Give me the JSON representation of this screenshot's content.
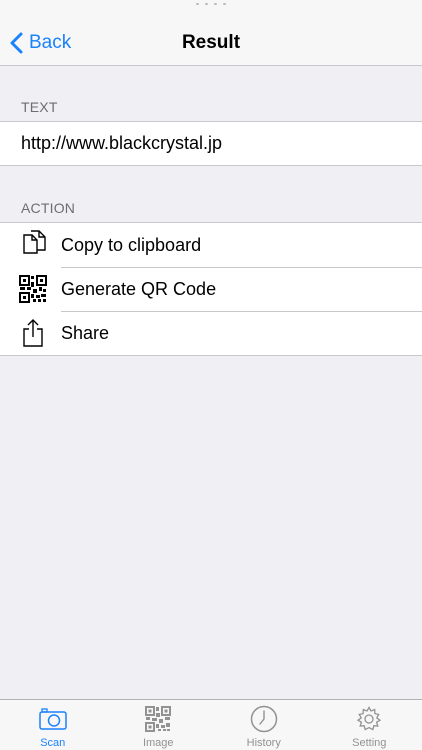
{
  "navbar": {
    "back_label": "Back",
    "title": "Result"
  },
  "text_section": {
    "header": "TEXT",
    "value": "http://www.blackcrystal.jp"
  },
  "action_section": {
    "header": "ACTION",
    "items": [
      {
        "label": "Copy to clipboard",
        "icon": "copy-icon"
      },
      {
        "label": "Generate QR Code",
        "icon": "qr-code-icon"
      },
      {
        "label": "Share",
        "icon": "share-icon"
      }
    ]
  },
  "tabbar": {
    "tabs": [
      {
        "label": "Scan",
        "icon": "camera-icon",
        "active": true
      },
      {
        "label": "Image",
        "icon": "qr-image-icon",
        "active": false
      },
      {
        "label": "History",
        "icon": "clock-icon",
        "active": false
      },
      {
        "label": "Setting",
        "icon": "gear-icon",
        "active": false
      }
    ]
  },
  "colors": {
    "accent": "#1a82fb",
    "background": "#efeff4",
    "inactive_tab": "#929292"
  }
}
